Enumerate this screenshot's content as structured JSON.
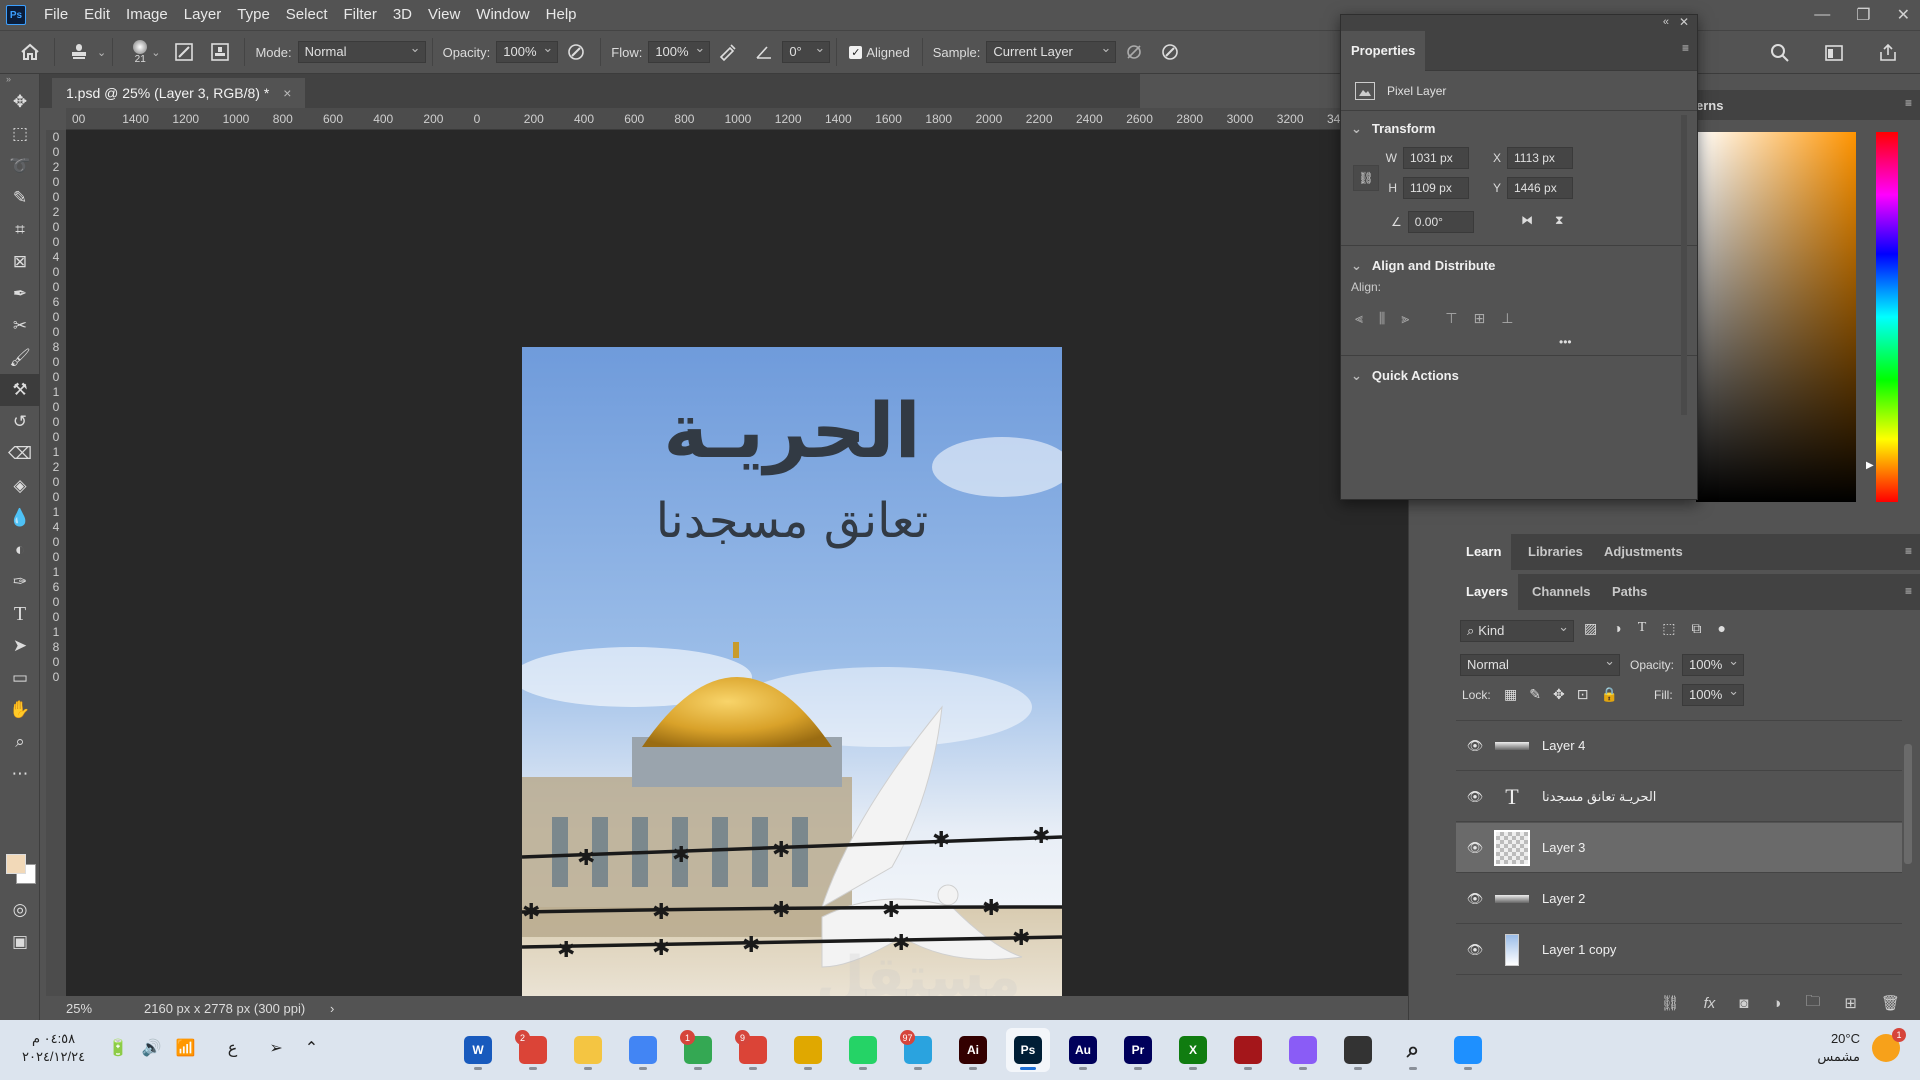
{
  "app": {
    "logo": "Ps"
  },
  "menu": [
    "File",
    "Edit",
    "Image",
    "Layer",
    "Type",
    "Select",
    "Filter",
    "3D",
    "View",
    "Window",
    "Help"
  ],
  "window_controls": {
    "minimize": "—",
    "restore": "❐",
    "close": "✕"
  },
  "options": {
    "brush_size": "21",
    "mode_label": "Mode:",
    "mode_value": "Normal",
    "opacity_label": "Opacity:",
    "opacity_value": "100%",
    "flow_label": "Flow:",
    "flow_value": "100%",
    "angle_value": "0°",
    "aligned_label": "Aligned",
    "sample_label": "Sample:",
    "sample_value": "Current Layer"
  },
  "document": {
    "tab_title": "1.psd @ 25% (Layer 3, RGB/8) *",
    "zoom": "25%",
    "doc_info": "2160 px x 2778 px (300 ppi)"
  },
  "ruler": {
    "h_ticks": [
      "00",
      "1400",
      "1200",
      "1000",
      "800",
      "600",
      "400",
      "200",
      "0",
      "200",
      "400",
      "600",
      "800",
      "1000",
      "1200",
      "1400",
      "1600",
      "1800",
      "2000",
      "2200",
      "2400",
      "2600",
      "2800",
      "3000",
      "3200",
      "3400"
    ],
    "v_digits": [
      "0",
      "0",
      "2",
      "0",
      "0",
      "",
      "",
      "2",
      "0",
      "0",
      "4",
      "0",
      "0",
      "6",
      "0",
      "0",
      "8",
      "0",
      "0",
      "1",
      "0",
      "0",
      "0",
      "1",
      "2",
      "0",
      "0",
      "1",
      "4",
      "0",
      "0",
      "1",
      "6",
      "0",
      "0",
      "1",
      "8",
      "0",
      "0"
    ]
  },
  "poster": {
    "title": "الحريـة",
    "subtitle": "تعانق مسجدنا"
  },
  "properties": {
    "tab": "Properties",
    "kind": "Pixel Layer",
    "transform_title": "Transform",
    "w_label": "W",
    "w_value": "1031 px",
    "x_label": "X",
    "x_value": "1113 px",
    "h_label": "H",
    "h_value": "1109 px",
    "y_label": "Y",
    "y_value": "1446 px",
    "angle_value": "0.00°",
    "align_title": "Align and Distribute",
    "align_label": "Align:",
    "more": "•••",
    "quick_actions": "Quick Actions"
  },
  "color_panel": {
    "tab_partial": "erns"
  },
  "learn_tabs": [
    "Learn",
    "Libraries",
    "Adjustments"
  ],
  "layers_tabs": [
    "Layers",
    "Channels",
    "Paths"
  ],
  "layers_panel": {
    "filter_kind": "Kind",
    "blend_mode": "Normal",
    "opacity_label": "Opacity:",
    "opacity_value": "100%",
    "lock_label": "Lock:",
    "fill_label": "Fill:",
    "fill_value": "100%",
    "layers": [
      {
        "name": "Layer 4",
        "kind": "pixel",
        "selected": false
      },
      {
        "name": "الحريـة تعانق مسجدنا",
        "kind": "text",
        "selected": false
      },
      {
        "name": "Layer 3",
        "kind": "pixel",
        "selected": true
      },
      {
        "name": "Layer 2",
        "kind": "pixel",
        "selected": false
      },
      {
        "name": "Layer 1 copy",
        "kind": "pixel",
        "selected": false
      }
    ],
    "footer": {
      "link": "⛓",
      "fx": "fx"
    }
  },
  "taskbar": {
    "time": "٠٤:٥٨ م",
    "date": "٢٠٢٤/١٢/٢٤",
    "lang": "ع",
    "weather_temp": "20°C",
    "weather_desc": "مشمس",
    "weather_badge": "1",
    "apps": [
      {
        "name": "Word",
        "label": "W",
        "color": "#185abd",
        "badge": ""
      },
      {
        "name": "Chrome",
        "label": "",
        "color": "#db4437",
        "badge": "2"
      },
      {
        "name": "File Explorer",
        "label": "",
        "color": "#f4c542",
        "badge": ""
      },
      {
        "name": "Chrome profile",
        "label": "",
        "color": "#4285f4",
        "badge": ""
      },
      {
        "name": "Chrome profile",
        "label": "",
        "color": "#34a853",
        "badge": "1"
      },
      {
        "name": "Chrome profile",
        "label": "",
        "color": "#db4437",
        "badge": "9"
      },
      {
        "name": "Chrome profile",
        "label": "",
        "color": "#e0a800",
        "badge": ""
      },
      {
        "name": "WhatsApp",
        "label": "",
        "color": "#25d366",
        "badge": ""
      },
      {
        "name": "Telegram",
        "label": "",
        "color": "#2aa3df",
        "badge": "97"
      },
      {
        "name": "Illustrator",
        "label": "Ai",
        "color": "#330000",
        "badge": ""
      },
      {
        "name": "Photoshop",
        "label": "Ps",
        "color": "#001e36",
        "badge": ""
      },
      {
        "name": "Audition",
        "label": "Au",
        "color": "#00005b",
        "badge": ""
      },
      {
        "name": "Premiere Pro",
        "label": "Pr",
        "color": "#00005b",
        "badge": ""
      },
      {
        "name": "Xbox",
        "label": "X",
        "color": "#107c10",
        "badge": ""
      },
      {
        "name": "App",
        "label": "",
        "color": "#a4161a",
        "badge": ""
      },
      {
        "name": "Copilot",
        "label": "",
        "color": "#8a5cf6",
        "badge": ""
      },
      {
        "name": "Task View",
        "label": "",
        "color": "#333333",
        "badge": ""
      },
      {
        "name": "Search",
        "label": "",
        "color": "#dce4ee",
        "badge": ""
      },
      {
        "name": "Start",
        "label": "",
        "color": "#1e90ff",
        "badge": ""
      }
    ]
  },
  "watermark": "مستقل"
}
